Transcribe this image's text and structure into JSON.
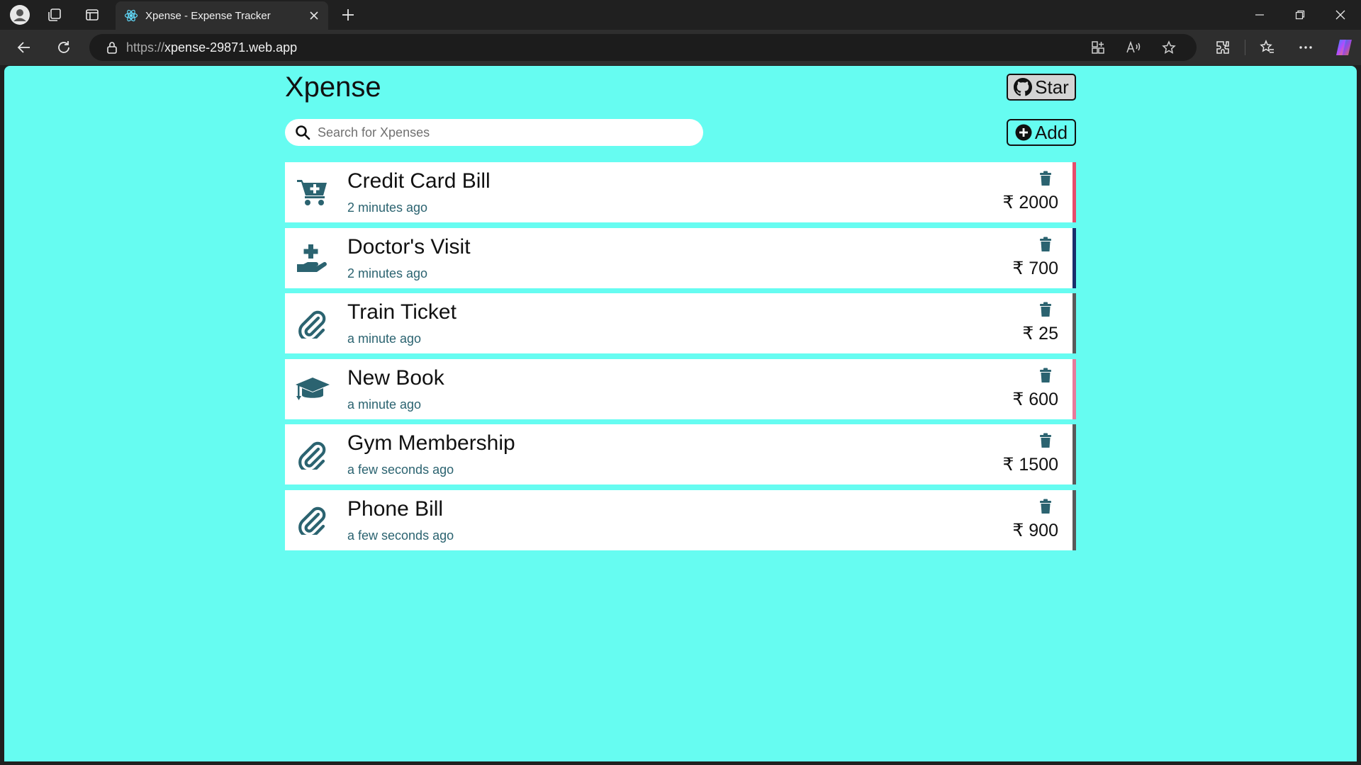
{
  "browser": {
    "tab_title": "Xpense - Expense Tracker",
    "url_protocol": "https://",
    "url_host": "xpense-29871.web.app"
  },
  "app": {
    "title": "Xpense",
    "star_label": "Star",
    "add_label": "Add",
    "search_placeholder": "Search for Xpenses"
  },
  "expenses": [
    {
      "name": "Credit Card Bill",
      "time": "2 minutes ago",
      "amount": "₹ 2000",
      "icon": "cart-plus-icon",
      "accent": "#e74c6b"
    },
    {
      "name": "Doctor's Visit",
      "time": "2 minutes ago",
      "amount": "₹ 700",
      "icon": "hand-holding-medical-icon",
      "accent": "#1a2f6b"
    },
    {
      "name": "Train Ticket",
      "time": "a minute ago",
      "amount": "₹ 25",
      "icon": "paperclip-icon",
      "accent": "#5a5a5a"
    },
    {
      "name": "New Book",
      "time": "a minute ago",
      "amount": "₹ 600",
      "icon": "graduation-cap-icon",
      "accent": "#e87a9a"
    },
    {
      "name": "Gym Membership",
      "time": "a few seconds ago",
      "amount": "₹ 1500",
      "icon": "paperclip-icon",
      "accent": "#5a5a5a"
    },
    {
      "name": "Phone Bill",
      "time": "a few seconds ago",
      "amount": "₹ 900",
      "icon": "paperclip-icon",
      "accent": "#5a5a5a"
    }
  ],
  "colors": {
    "page_background": "#66fcf1",
    "icon_color": "#2b6370"
  }
}
